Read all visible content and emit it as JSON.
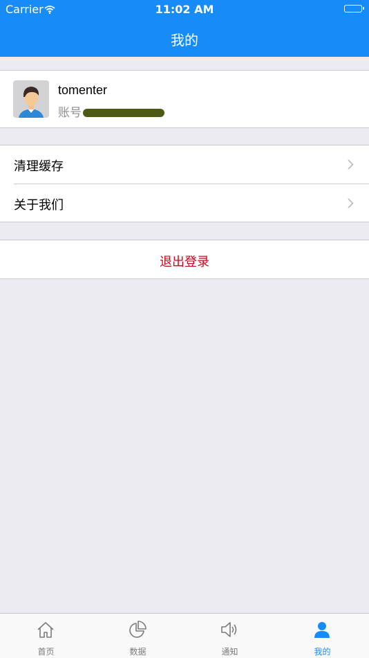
{
  "status_bar": {
    "carrier": "Carrier",
    "time": "11:02 AM"
  },
  "nav": {
    "title": "我的"
  },
  "profile": {
    "username": "tomenter",
    "account_label": "账号",
    "account_value": "redacted"
  },
  "menu": [
    {
      "label": "清理缓存"
    },
    {
      "label": "关于我们"
    }
  ],
  "logout": {
    "label": "退出登录"
  },
  "tabbar": [
    {
      "label": "首页",
      "icon": "home-icon"
    },
    {
      "label": "数据",
      "icon": "pie-chart-icon"
    },
    {
      "label": "通知",
      "icon": "speaker-icon"
    },
    {
      "label": "我的",
      "icon": "user-icon",
      "active": true
    }
  ],
  "colors": {
    "primary": "#178bf7",
    "logout": "#d0021b",
    "background": "#ebebf1"
  }
}
